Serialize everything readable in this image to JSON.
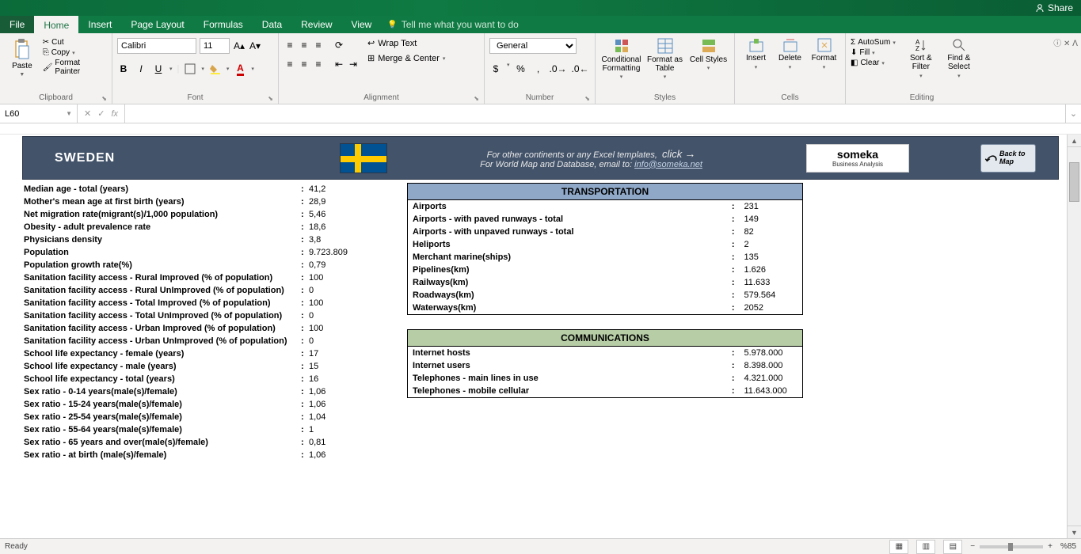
{
  "share": "Share",
  "tabs": [
    "File",
    "Home",
    "Insert",
    "Page Layout",
    "Formulas",
    "Data",
    "Review",
    "View"
  ],
  "tellme": "Tell me what you want to do",
  "ribbon": {
    "clipboard": {
      "paste": "Paste",
      "cut": "Cut",
      "copy": "Copy",
      "painter": "Format Painter",
      "label": "Clipboard"
    },
    "font": {
      "name": "Calibri",
      "size": "11",
      "label": "Font"
    },
    "alignment": {
      "wrap": "Wrap Text",
      "merge": "Merge & Center",
      "label": "Alignment"
    },
    "number": {
      "format": "General",
      "label": "Number"
    },
    "styles": {
      "cond": "Conditional Formatting",
      "table": "Format as Table",
      "cell": "Cell Styles",
      "label": "Styles"
    },
    "cells": {
      "insert": "Insert",
      "delete": "Delete",
      "format": "Format",
      "label": "Cells"
    },
    "editing": {
      "sum": "AutoSum",
      "fill": "Fill",
      "clear": "Clear",
      "sort": "Sort & Filter",
      "find": "Find & Select",
      "label": "Editing"
    }
  },
  "namebox": "L60",
  "banner": {
    "country": "SWEDEN",
    "promo1": "For other continents or any Excel templates,",
    "click": "click",
    "promo2": "For World Map and Database, email to:",
    "email": "info@someka.net",
    "someka": "someka",
    "someka_sub": "Business Analysis",
    "back": "Back to Map"
  },
  "left_rows": [
    [
      "Median age - total (years)",
      "41,2"
    ],
    [
      "Mother's mean age at first birth (years)",
      "28,9"
    ],
    [
      "Net migration rate(migrant(s)/1,000 population)",
      "5,46"
    ],
    [
      "Obesity - adult prevalence rate",
      "18,6"
    ],
    [
      "Physicians density",
      "3,8"
    ],
    [
      "Population",
      "9.723.809"
    ],
    [
      "Population growth rate(%)",
      "0,79"
    ],
    [
      "Sanitation facility access - Rural Improved (% of population)",
      "100"
    ],
    [
      "Sanitation facility access - Rural UnImproved (% of population)",
      "0"
    ],
    [
      "Sanitation facility access - Total Improved (% of population)",
      "100"
    ],
    [
      "Sanitation facility access - Total UnImproved (% of population)",
      "0"
    ],
    [
      "Sanitation facility access - Urban Improved (% of population)",
      "100"
    ],
    [
      "Sanitation facility access - Urban UnImproved (% of population)",
      "0"
    ],
    [
      "School life expectancy - female (years)",
      "17"
    ],
    [
      "School life expectancy - male (years)",
      "15"
    ],
    [
      "School life expectancy - total (years)",
      "16"
    ],
    [
      "Sex ratio - 0-14 years(male(s)/female)",
      "1,06"
    ],
    [
      "Sex ratio - 15-24 years(male(s)/female)",
      "1,06"
    ],
    [
      "Sex ratio - 25-54 years(male(s)/female)",
      "1,04"
    ],
    [
      "Sex ratio - 55-64 years(male(s)/female)",
      "1"
    ],
    [
      "Sex ratio - 65 years and over(male(s)/female)",
      "0,81"
    ],
    [
      "Sex ratio - at birth (male(s)/female)",
      "1,06"
    ]
  ],
  "transport": {
    "title": "TRANSPORTATION",
    "rows": [
      [
        "Airports",
        "231"
      ],
      [
        "Airports - with paved runways - total",
        "149"
      ],
      [
        "Airports - with unpaved runways - total",
        "82"
      ],
      [
        "Heliports",
        "2"
      ],
      [
        "Merchant marine(ships)",
        "135"
      ],
      [
        "Pipelines(km)",
        "1.626"
      ],
      [
        "Railways(km)",
        "11.633"
      ],
      [
        "Roadways(km)",
        "579.564"
      ],
      [
        "Waterways(km)",
        "2052"
      ]
    ]
  },
  "comms": {
    "title": "COMMUNICATIONS",
    "rows": [
      [
        "Internet hosts",
        "5.978.000"
      ],
      [
        "Internet users",
        "8.398.000"
      ],
      [
        "Telephones - main lines in use",
        "4.321.000"
      ],
      [
        "Telephones - mobile cellular",
        "11.643.000"
      ]
    ]
  },
  "status": {
    "ready": "Ready",
    "zoom": "%85"
  }
}
